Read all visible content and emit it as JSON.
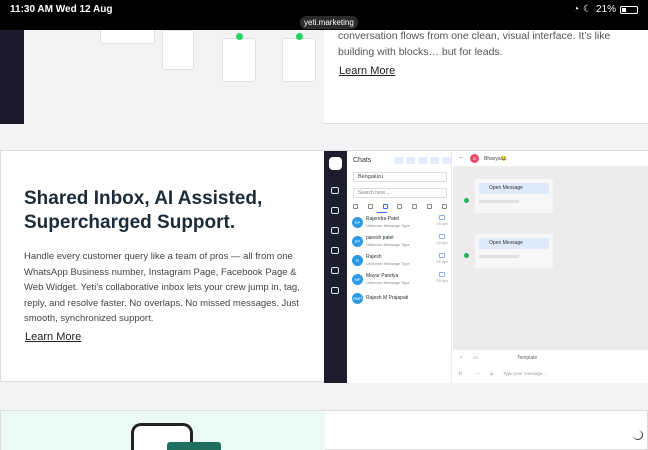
{
  "status_bar": {
    "time": "11:30 AM",
    "date": "Wed 12 Aug",
    "url": "yeti.marketing",
    "battery": "21%"
  },
  "top_card": {
    "text": "conversation flows from one clean, visual interface. It’s like building with blocks… but for leads.",
    "link": "Learn More"
  },
  "inbox_card": {
    "title": "Shared Inbox, AI Assisted, Supercharged Support.",
    "description": "Handle every customer query like a team of pros — all from one WhatsApp Business number, Instagram Page, Facebook Page & Web Widget. Yeti’s collaborative inbox lets your crew jump in, tag, reply, and resolve faster. No overlaps. No missed messages. Just smooth, synchronized support.",
    "link": "Learn More"
  },
  "app": {
    "chats_title": "Chats",
    "location": "Bengaluru",
    "search_placeholder": "Search here...",
    "contacts": [
      {
        "initials": "RP",
        "name": "Rajendra Patel",
        "sub": "Unknown Message Type",
        "date": "05 Apr"
      },
      {
        "initials": "PP",
        "name": "paresh patel",
        "sub": "Unknown Message Type",
        "date": "05 Apr"
      },
      {
        "initials": "R",
        "name": "Rajesh",
        "sub": "Unknown Message Type",
        "date": "05 Apr"
      },
      {
        "initials": "MP",
        "name": "Mayur Pandya",
        "sub": "Unknown Message Type",
        "date": "05 Apr"
      },
      {
        "initials": "RMP",
        "name": "Rajesh M Prajapati",
        "sub": "",
        "date": ""
      }
    ],
    "conversation": {
      "avatar": "B",
      "name": "Bhavya😂",
      "messages": [
        "Open Message",
        "Open Message"
      ],
      "template_label": "Template",
      "input_placeholder": "Type your message..."
    }
  },
  "colors": {
    "accent": "#3b6cf0",
    "rail": "#1d1d2e",
    "whatsapp": "#25d366"
  }
}
